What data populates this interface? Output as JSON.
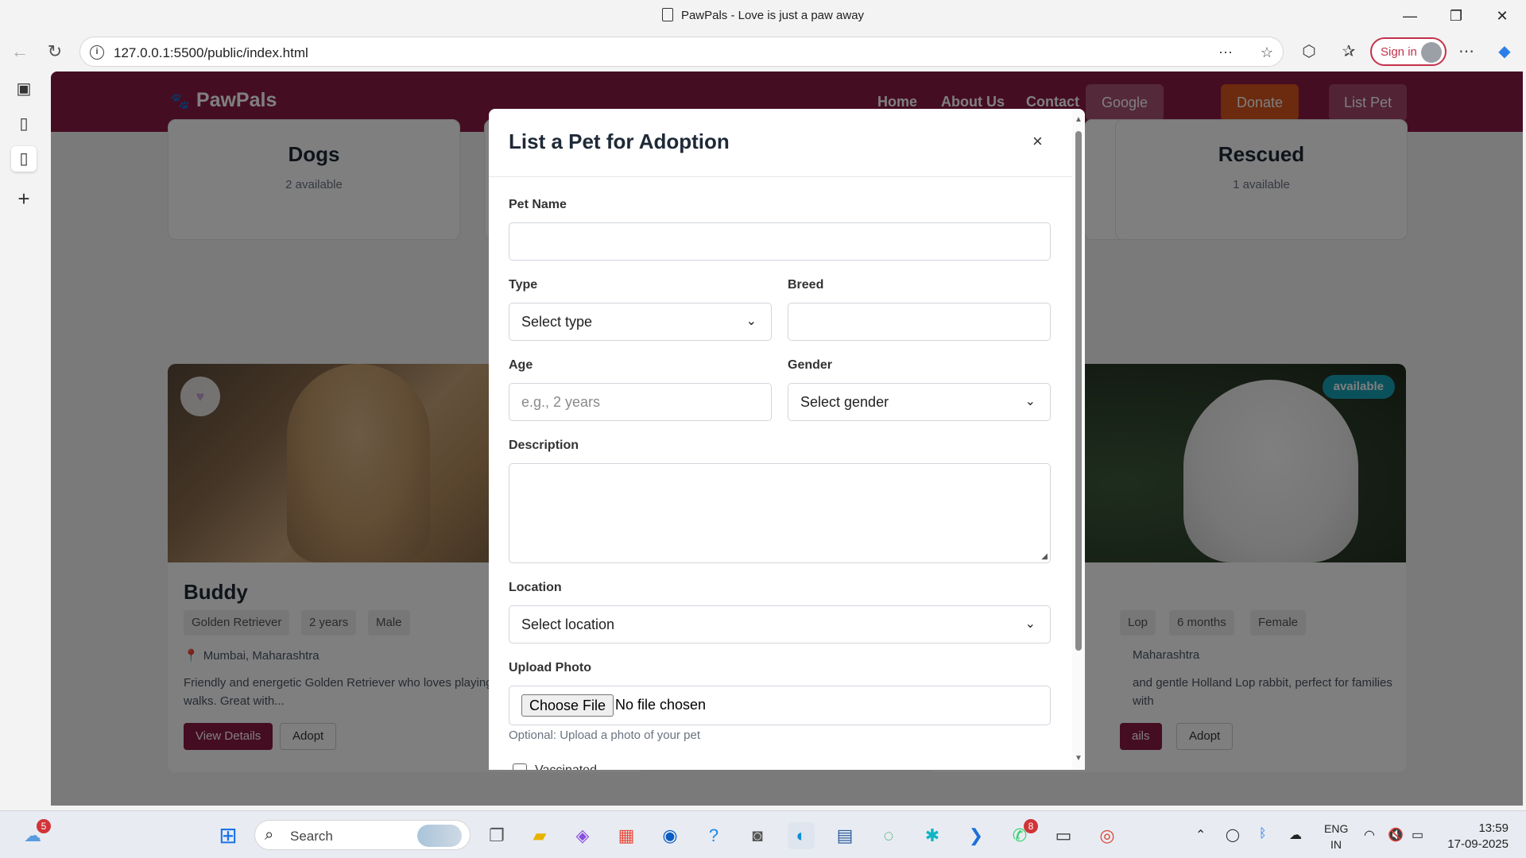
{
  "window": {
    "title": "PawPals - Love is just a paw away",
    "minimize": "—",
    "restore": "❐",
    "close": "✕"
  },
  "browser": {
    "url": "127.0.0.1:5500/public/index.html",
    "sign_in": "Sign in",
    "info_glyph": "i"
  },
  "site": {
    "brand": "PawPals",
    "nav": {
      "home": "Home",
      "about": "About Us",
      "contact": "Contact",
      "google": "Google",
      "donate": "Donate",
      "list_pet": "List Pet"
    },
    "categories": [
      {
        "name": "Dogs",
        "count": "2 available"
      },
      {
        "name": "Rescued",
        "count": "1 available"
      }
    ],
    "pets": [
      {
        "name": "Buddy",
        "tags": [
          "Golden Retriever",
          "2 years",
          "Male"
        ],
        "location": "Mumbai, Maharashtra",
        "description": "Friendly and energetic Golden Retriever who loves playing fetch and going for long walks. Great with...",
        "view": "View Details",
        "adopt": "Adopt"
      },
      {
        "badge": "available",
        "tags": [
          "Lop",
          "6 months",
          "Female"
        ],
        "location": "Maharashtra",
        "description": "and gentle Holland Lop rabbit, perfect for families with",
        "view": "ails",
        "adopt": "Adopt"
      }
    ]
  },
  "modal": {
    "title": "List a Pet for Adoption",
    "close": "×",
    "fields": {
      "pet_name": {
        "label": "Pet Name",
        "value": ""
      },
      "type": {
        "label": "Type",
        "value": "Select type"
      },
      "breed": {
        "label": "Breed",
        "value": ""
      },
      "age": {
        "label": "Age",
        "placeholder": "e.g., 2 years"
      },
      "gender": {
        "label": "Gender",
        "value": "Select gender"
      },
      "description": {
        "label": "Description",
        "value": ""
      },
      "location": {
        "label": "Location",
        "value": "Select location"
      },
      "photo": {
        "label": "Upload Photo",
        "button": "Choose File",
        "status": "No file chosen",
        "hint": "Optional: Upload a photo of your pet"
      },
      "vaccinated": {
        "label": "Vaccinated"
      }
    }
  },
  "taskbar": {
    "search": "Search",
    "weather_badge": "5",
    "whatsapp_badge": "8",
    "lang_top": "ENG",
    "lang_bottom": "IN",
    "time": "13:59",
    "date": "17-09-2025"
  },
  "colors": {
    "brand": "#8b1a45",
    "donate": "#d9541e",
    "badge": "#17a2b8",
    "signin": "#c4314b"
  }
}
